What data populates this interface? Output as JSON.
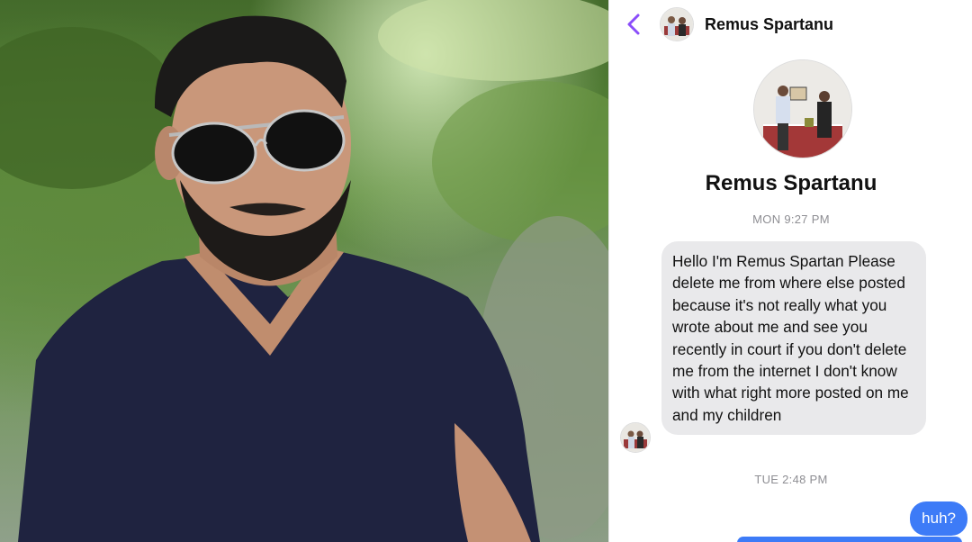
{
  "photo": {
    "description_icon": "portrait-photo"
  },
  "chat": {
    "header": {
      "back_icon": "chevron-left-icon",
      "name": "Remus Spartanu"
    },
    "profile": {
      "name": "Remus Spartanu"
    },
    "messages": [
      {
        "timestamp": "MON 9:27 PM",
        "direction": "incoming",
        "text": "Hello I'm Remus Spartan Please delete me from where else posted because it's not really what you wrote about me and see you recently in court if you don't delete me from the internet I don't know with what right more posted on me  and my children"
      },
      {
        "timestamp": "TUE 2:48 PM",
        "direction": "outgoing",
        "text": "huh?"
      }
    ],
    "colors": {
      "accent": "#8a4dfa",
      "outgoing_bubble": "#3d7bf7",
      "incoming_bubble": "#e9e9eb"
    }
  }
}
